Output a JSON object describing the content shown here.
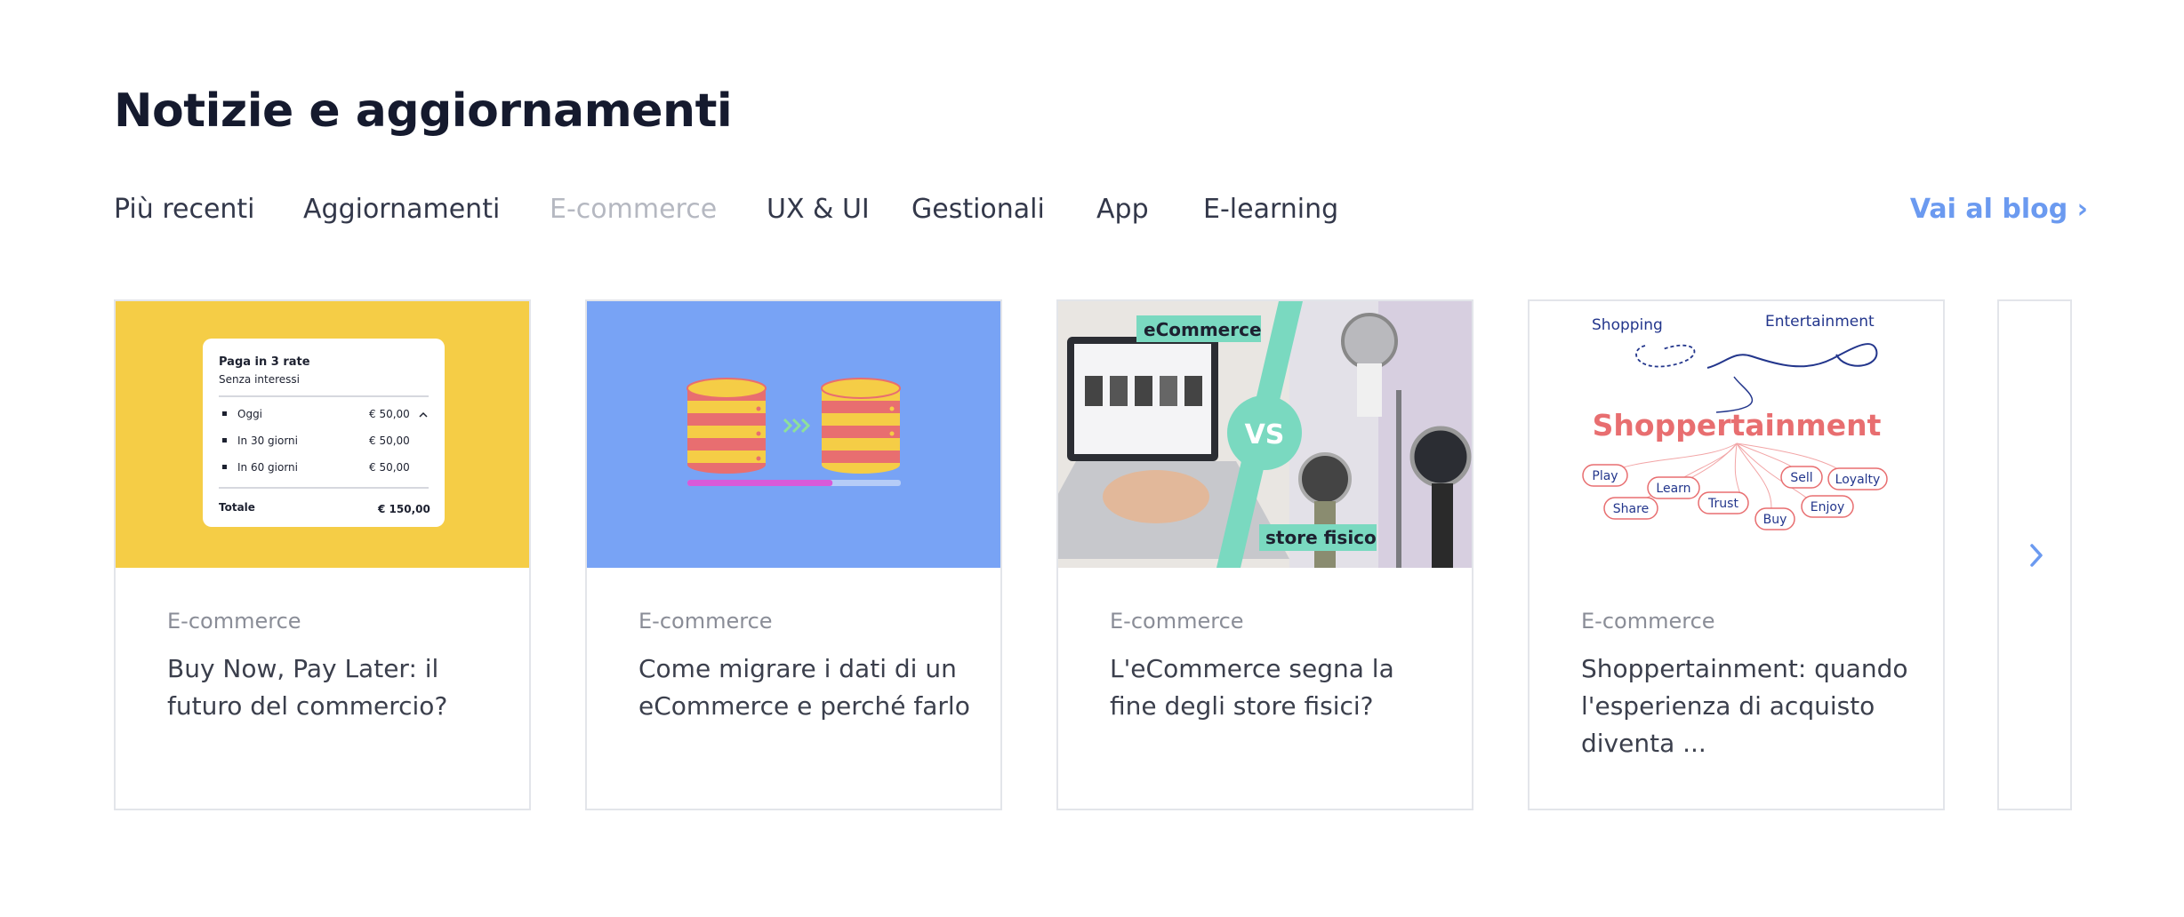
{
  "section": {
    "title": "Notizie e aggiornamenti"
  },
  "tabs": [
    {
      "label": "Più recenti"
    },
    {
      "label": "Aggiornamenti"
    },
    {
      "label": "E-commerce",
      "active": true
    },
    {
      "label": "UX & UI"
    },
    {
      "label": "Gestionali"
    },
    {
      "label": "App"
    },
    {
      "label": "E-learning"
    }
  ],
  "blog_link": "Vai al blog ›",
  "cards": [
    {
      "category": "E-commerce",
      "title": "Buy Now, Pay Later: il futuro del commercio?",
      "image": {
        "bg": "#f5cd46",
        "heading": "Paga in 3 rate",
        "subheading": "Senza interessi",
        "rows": [
          {
            "label": "Oggi",
            "amount": "€ 50,00"
          },
          {
            "label": "In 30 giorni",
            "amount": "€ 50,00"
          },
          {
            "label": "In 60 giorni",
            "amount": "€ 50,00"
          }
        ],
        "total_label": "Totale",
        "total_amount": "€ 150,00"
      }
    },
    {
      "category": "E-commerce",
      "title": "Come migrare i dati di un eCommerce e perché farlo",
      "image": {
        "bg": "#78a3f5",
        "icon": "database-migration-icon",
        "progress": 0.68
      }
    },
    {
      "category": "E-commerce",
      "title": "L'eCommerce segna la fine degli store fisici?",
      "image": {
        "label_top": "eCommerce",
        "label_vs": "VS",
        "label_bottom": "store fisico",
        "accent": "#7ad9c0"
      }
    },
    {
      "category": "E-commerce",
      "title": "Shoppertainment: quando l'esperienza di acquisto diventa ...",
      "image": {
        "label_left": "Shopping",
        "label_right": "Entertainment",
        "headline": "Shoppertainment",
        "tags": [
          "Play",
          "Learn",
          "Sell",
          "Loyalty",
          "Share",
          "Trust",
          "Buy",
          "Enjoy"
        ]
      }
    }
  ],
  "colors": {
    "accent": "#6b9af0",
    "title": "#151a2e",
    "muted": "#8a8d97",
    "active_tab": "#b5b8c1"
  }
}
